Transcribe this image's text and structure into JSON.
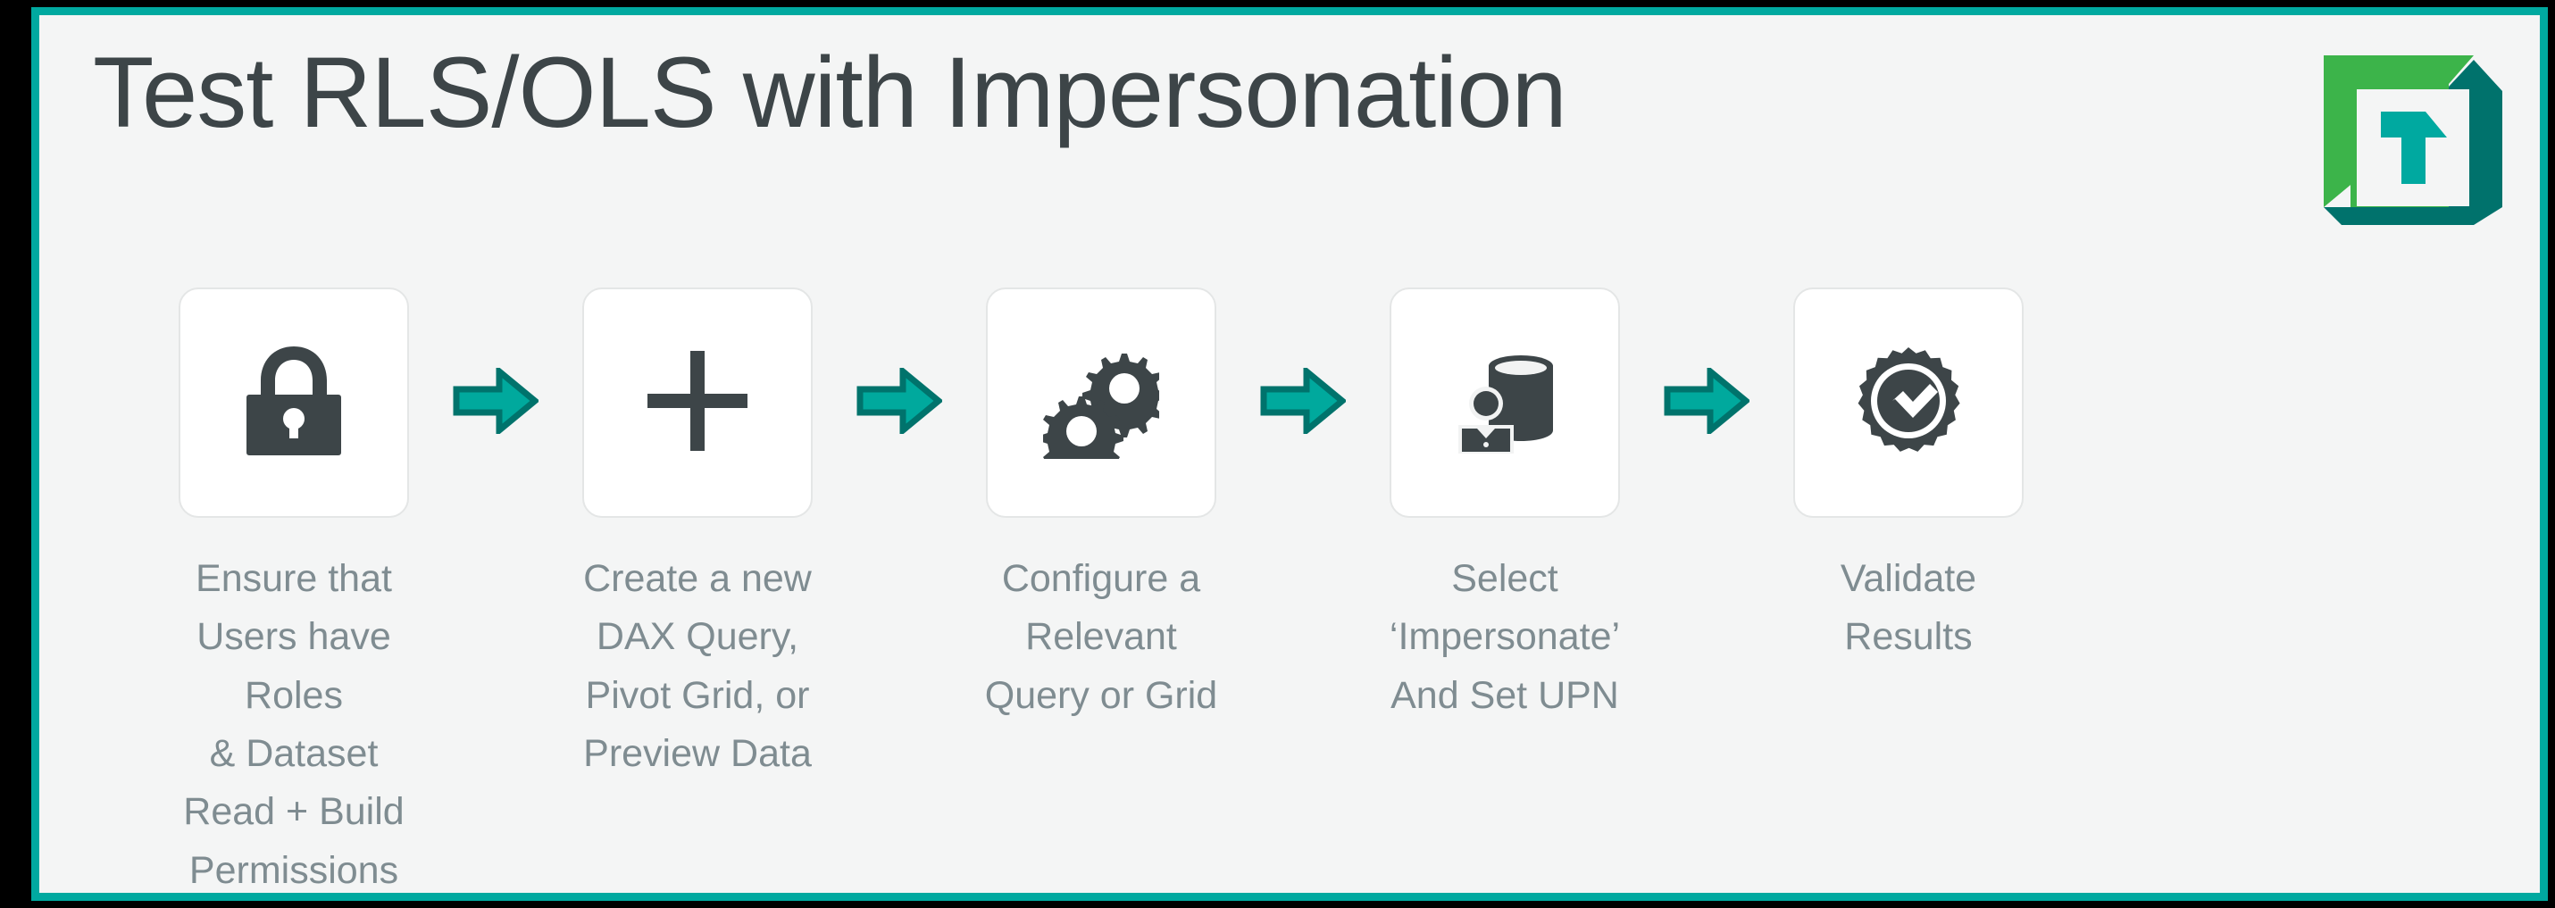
{
  "colors": {
    "slide_background": "#f4f5f5",
    "frame_border": "#00a9a0",
    "outer_matte": "#000000",
    "title_text": "#3d4548",
    "caption_text": "#7f8c91",
    "icon_dark": "#3d4548",
    "card_background": "#ffffff",
    "card_border": "#e4e6e6",
    "arrow_fill": "#00a99d",
    "arrow_outline": "#00736c",
    "logo_green": "#3cb44a",
    "logo_teal": "#00a9a0",
    "logo_teal_dark": "#00726c"
  },
  "header": {
    "title": "Test RLS/OLS with Impersonation",
    "logo_name": "tabular-editor-logo",
    "logo_letter": "T"
  },
  "flow": {
    "arrow_icon_name": "right-arrow-icon",
    "arrow_count": 4,
    "steps": [
      {
        "index": 1,
        "icon": "lock-icon",
        "label": "Ensure that\nUsers have Roles\n& Dataset\nRead + Build\nPermissions"
      },
      {
        "index": 2,
        "icon": "plus-icon",
        "label": "Create a new\nDAX Query,\nPivot Grid, or\nPreview Data"
      },
      {
        "index": 3,
        "icon": "gears-icon",
        "label": "Configure a\nRelevant\nQuery or Grid"
      },
      {
        "index": 4,
        "icon": "database-user-icon",
        "label": "Select ‘Impersonate’\nAnd Set UPN"
      },
      {
        "index": 5,
        "icon": "verified-badge-icon",
        "label": "Validate\nResults"
      }
    ]
  }
}
